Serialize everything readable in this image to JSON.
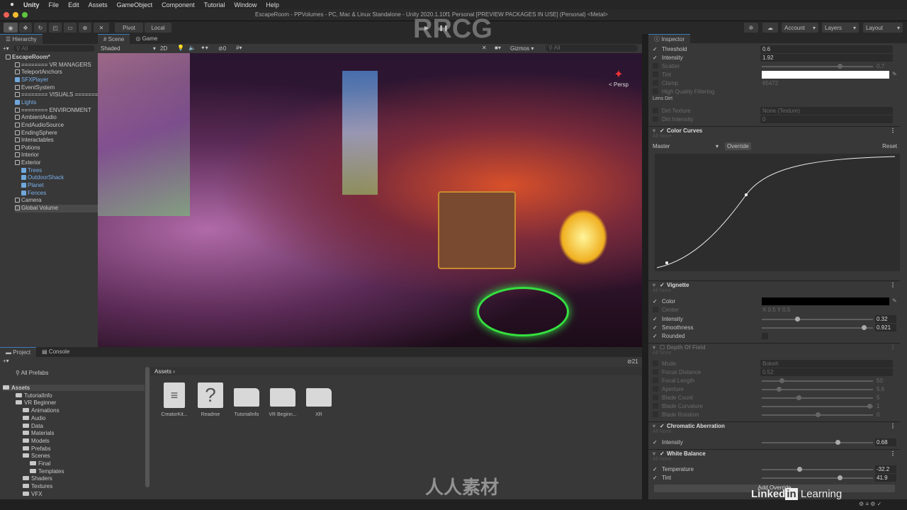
{
  "menu": {
    "apple": "",
    "app": "Unity",
    "items": [
      "File",
      "Edit",
      "Assets",
      "GameObject",
      "Component",
      "Tutorial",
      "Window",
      "Help"
    ]
  },
  "window_title": "EscapeRoom - PPVolumes - PC, Mac & Linux Standalone - Unity 2020.1.10f1 Personal [PREVIEW PACKAGES IN USE] (Personal) <Metal>",
  "toolbar": {
    "pivot": "Pivot",
    "local": "Local",
    "account": "Account",
    "layers": "Layers",
    "layout": "Layout"
  },
  "hierarchy": {
    "title": "Hierarchy",
    "search": "All",
    "items": [
      {
        "label": "EscapeRoom*",
        "depth": 0,
        "bold": true
      },
      {
        "label": "======== VR MANAGERS",
        "depth": 1
      },
      {
        "label": "TeleportAnchors",
        "depth": 1
      },
      {
        "label": "SFXPlayer",
        "depth": 1,
        "prefab": true
      },
      {
        "label": "EventSystem",
        "depth": 1
      },
      {
        "label": "======== VISUALS ========",
        "depth": 1
      },
      {
        "label": "Lights",
        "depth": 1,
        "prefab": true
      },
      {
        "label": "======== ENVIRONMENT",
        "depth": 1
      },
      {
        "label": "AmbientAudio",
        "depth": 1
      },
      {
        "label": "EndAudioSource",
        "depth": 1
      },
      {
        "label": "EndingSphere",
        "depth": 1
      },
      {
        "label": "Interactables",
        "depth": 1
      },
      {
        "label": "Potions",
        "depth": 1
      },
      {
        "label": "Interior",
        "depth": 1
      },
      {
        "label": "Exterior",
        "depth": 1
      },
      {
        "label": "Trees",
        "depth": 2,
        "prefab": true
      },
      {
        "label": "OutdoorShack",
        "depth": 2,
        "prefab": true
      },
      {
        "label": "Planet",
        "depth": 2,
        "prefab": true
      },
      {
        "label": "Fences",
        "depth": 2,
        "prefab": true
      },
      {
        "label": "Camera",
        "depth": 1
      },
      {
        "label": "Global Volume",
        "depth": 1
      }
    ]
  },
  "scene": {
    "tabs": [
      "Scene",
      "Game"
    ],
    "shading": "Shaded",
    "mode_2d": "2D",
    "gizmos": "Gizmos",
    "search": "All",
    "persp": "< Persp",
    "hidden_count": "0"
  },
  "inspector": {
    "title": "Inspector",
    "rows": [
      {
        "type": "prop",
        "label": "Threshold",
        "value": "0.6",
        "on": true,
        "kind": "field"
      },
      {
        "type": "prop",
        "label": "Intensity",
        "value": "1.92",
        "on": true,
        "kind": "field"
      },
      {
        "type": "prop",
        "label": "Scatter",
        "value": "0.7",
        "dim": true,
        "kind": "slider",
        "fraction": 0.7
      },
      {
        "type": "prop",
        "label": "Tint",
        "dim": true,
        "kind": "color",
        "color": "#ffffff"
      },
      {
        "type": "prop",
        "label": "Clamp",
        "value": "65472",
        "dim": true,
        "kind": "text"
      },
      {
        "type": "prop",
        "label": "High Quality Filtering",
        "dim": true,
        "kind": "none"
      },
      {
        "type": "sub",
        "label": "Lens Dirt"
      },
      {
        "type": "prop",
        "label": "Dirt Texture",
        "value": "None (Texture)",
        "dim": true,
        "kind": "field"
      },
      {
        "type": "prop",
        "label": "Dirt Intensity",
        "value": "0",
        "dim": true,
        "kind": "field"
      },
      {
        "type": "section",
        "label": "Color Curves",
        "on": true
      },
      {
        "type": "allnone",
        "label": "All  None"
      },
      {
        "type": "curvebar",
        "master": "Master",
        "override": "Override",
        "reset": "Reset"
      },
      {
        "type": "section",
        "label": "Vignette",
        "on": true
      },
      {
        "type": "allnone",
        "label": "All  None"
      },
      {
        "type": "prop",
        "label": "Color",
        "on": true,
        "kind": "color",
        "color": "#000000"
      },
      {
        "type": "prop",
        "label": "Center",
        "value": "X 0.5        Y 0.5",
        "dim": true,
        "kind": "text"
      },
      {
        "type": "prop",
        "label": "Intensity",
        "value": "0.32",
        "on": true,
        "kind": "slider",
        "fraction": 0.32
      },
      {
        "type": "prop",
        "label": "Smoothness",
        "value": "0.921",
        "on": true,
        "kind": "slider",
        "fraction": 0.92
      },
      {
        "type": "prop",
        "label": "Rounded",
        "on": true,
        "kind": "check"
      },
      {
        "type": "section",
        "label": "Depth Of Field",
        "dim": true
      },
      {
        "type": "allnone",
        "label": "All  None"
      },
      {
        "type": "prop",
        "label": "Mode",
        "value": "Bokeh",
        "dim": true,
        "kind": "field"
      },
      {
        "type": "prop",
        "label": "Focus Distance",
        "value": "0.52",
        "dim": true,
        "kind": "field"
      },
      {
        "type": "prop",
        "label": "Focal Length",
        "value": "50",
        "dim": true,
        "kind": "slider",
        "fraction": 0.18
      },
      {
        "type": "prop",
        "label": "Aperture",
        "value": "5.6",
        "dim": true,
        "kind": "slider",
        "fraction": 0.15
      },
      {
        "type": "prop",
        "label": "Blade Count",
        "value": "5",
        "dim": true,
        "kind": "slider",
        "fraction": 0.33
      },
      {
        "type": "prop",
        "label": "Blade Curvature",
        "value": "1",
        "dim": true,
        "kind": "slider",
        "fraction": 0.97
      },
      {
        "type": "prop",
        "label": "Blade Rotation",
        "value": "0",
        "dim": true,
        "kind": "slider",
        "fraction": 0.5
      },
      {
        "type": "section",
        "label": "Chromatic Aberration",
        "on": true
      },
      {
        "type": "allnone",
        "label": "All  None"
      },
      {
        "type": "prop",
        "label": "Intensity",
        "value": "0.68",
        "on": true,
        "kind": "slider",
        "fraction": 0.68
      },
      {
        "type": "section",
        "label": "White Balance",
        "on": true
      },
      {
        "type": "allnone",
        "label": "All  None"
      },
      {
        "type": "prop",
        "label": "Temperature",
        "value": "-32.2",
        "on": true,
        "kind": "slider",
        "fraction": 0.34
      },
      {
        "type": "prop",
        "label": "Tint",
        "value": "41.9",
        "on": true,
        "kind": "slider",
        "fraction": 0.7
      }
    ],
    "add_override": "Add Override"
  },
  "project": {
    "tabs": [
      "Project",
      "Console"
    ],
    "favorites": [
      "All Prefabs"
    ],
    "breadcrumb": "Assets",
    "count": "21",
    "tree": [
      {
        "label": "Assets",
        "depth": 0
      },
      {
        "label": "TutorialInfo",
        "depth": 1
      },
      {
        "label": "VR Beginner",
        "depth": 1
      },
      {
        "label": "Animations",
        "depth": 2
      },
      {
        "label": "Audio",
        "depth": 2
      },
      {
        "label": "Data",
        "depth": 2
      },
      {
        "label": "Materials",
        "depth": 2
      },
      {
        "label": "Models",
        "depth": 2
      },
      {
        "label": "Prefabs",
        "depth": 2
      },
      {
        "label": "Scenes",
        "depth": 2
      },
      {
        "label": "Final",
        "depth": 3
      },
      {
        "label": "Templates",
        "depth": 3
      },
      {
        "label": "Shaders",
        "depth": 2
      },
      {
        "label": "Textures",
        "depth": 2
      },
      {
        "label": "VFX",
        "depth": 2
      }
    ],
    "assets": [
      {
        "label": "CreatorKit...",
        "icon": "document"
      },
      {
        "label": "Readme",
        "icon": "question"
      },
      {
        "label": "TutorialInfo",
        "icon": "folder"
      },
      {
        "label": "VR Beginn...",
        "icon": "folder"
      },
      {
        "label": "XR",
        "icon": "folder"
      }
    ]
  },
  "watermark": {
    "rrcg": "RRCG",
    "cn": "人人素材",
    "linkedin": "Linked in Learning"
  }
}
